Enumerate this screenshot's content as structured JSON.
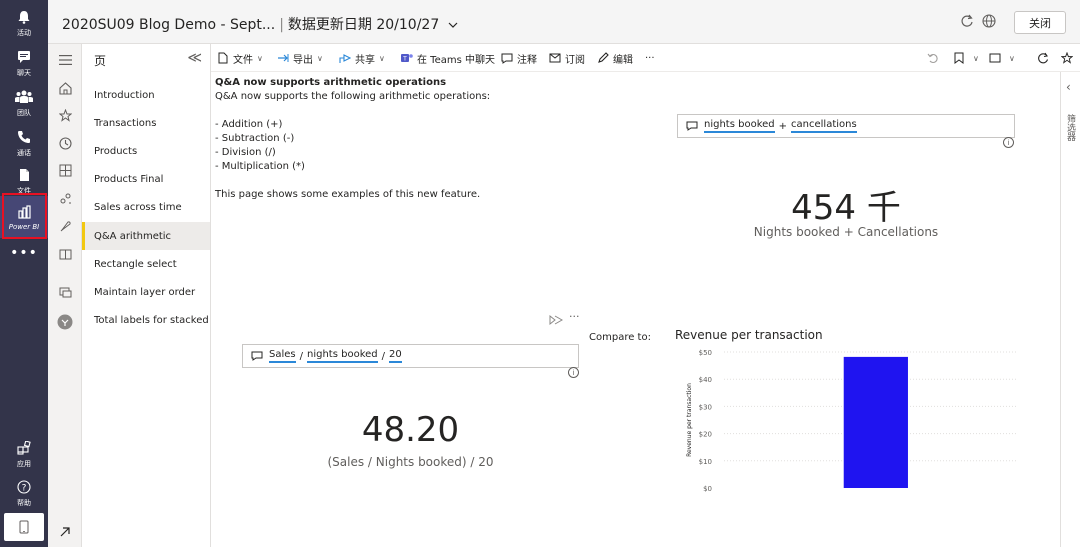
{
  "rail": {
    "items": [
      {
        "name": "activity",
        "label": "活动",
        "icon": "bell-icon"
      },
      {
        "name": "chat",
        "label": "聊天",
        "icon": "chat-icon"
      },
      {
        "name": "teams",
        "label": "团队",
        "icon": "teams-icon"
      },
      {
        "name": "calls",
        "label": "通话",
        "icon": "phone-icon"
      },
      {
        "name": "files",
        "label": "文件",
        "icon": "file-icon"
      },
      {
        "name": "powerbi",
        "label": "Power BI",
        "icon": "powerbi-icon"
      }
    ],
    "more": "•••",
    "apps_label": "应用",
    "help_label": "帮助"
  },
  "titlebar": {
    "title": "2020SU09 Blog Demo - Sept...",
    "separator": "|",
    "updated": "数据更新日期 20/10/27",
    "close_label": "关闭"
  },
  "pages": {
    "header": "页",
    "collapse": "≪",
    "items": [
      "Introduction",
      "Transactions",
      "Products",
      "Products Final",
      "Sales across time",
      "Q&A arithmetic",
      "Rectangle select",
      "Maintain layer order",
      "Total labels for stacked ..."
    ],
    "selected_index": 5
  },
  "toolbar": {
    "file": "文件",
    "export": "导出",
    "share": "共享",
    "teams_chat": "在 Teams 中聊天",
    "comment": "注释",
    "subscribe": "订阅",
    "edit": "编辑",
    "more": "···"
  },
  "textbox": {
    "title": "Q&A now supports arithmetic operations",
    "intro": "Q&A now supports the following arithmetic operations:",
    "ops": [
      "- Addition (+)",
      "- Subtraction (-)",
      "- Division (/)",
      "- Multiplication (*)"
    ],
    "footer": "This page shows some examples of this new feature."
  },
  "qa1": {
    "term1": "nights booked",
    "op": "+",
    "term2": "cancellations",
    "value": "454 千",
    "label": "Nights booked + Cancellations"
  },
  "qa2": {
    "term1": "Sales",
    "op1": "/",
    "term2": "nights booked",
    "op2": "/",
    "term3": "20",
    "value": "48.20",
    "label": "(Sales / Nights booked) / 20"
  },
  "compare_label": "Compare to:",
  "visual_more": "···",
  "filters_label": "筛选器",
  "colors": {
    "rail": "#33344a",
    "bar": "#1f14f0",
    "qa_underline": "#2b88d8",
    "page_accent": "#f2c811",
    "highlight": "#e81123"
  },
  "chart_data": {
    "type": "bar",
    "title": "Revenue per transaction",
    "ylabel": "Revenue per transaction",
    "ytick_labels": [
      "$50",
      "$40",
      "$30",
      "$20",
      "$10",
      "$0"
    ],
    "ylim": [
      0,
      50
    ],
    "grid": true,
    "categories": [
      ""
    ],
    "values": [
      48.2
    ]
  }
}
